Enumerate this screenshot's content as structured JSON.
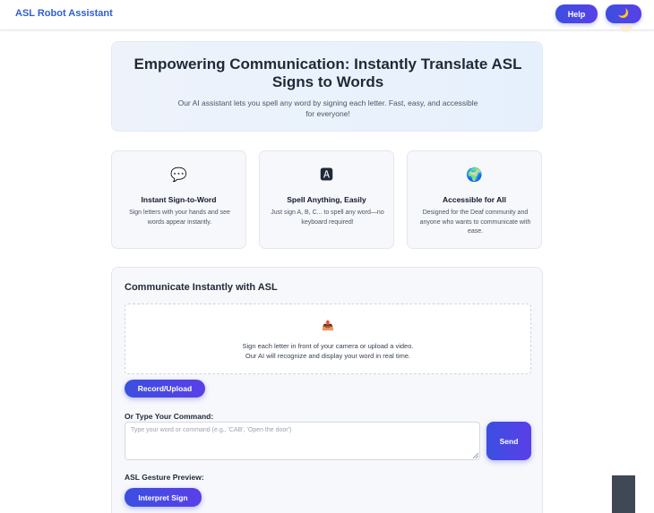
{
  "navbar": {
    "brand": "ASL Robot Assistant",
    "help_label": "Help",
    "theme_toggle_icon": "moon-icon",
    "theme_toggle_glyph": "🌙"
  },
  "hero": {
    "title": "Empowering Communication: Instantly Translate ASL Signs to Words",
    "subtitle": "Our AI assistant lets you spell any word by signing each letter. Fast, easy, and accessible for everyone!"
  },
  "features": [
    {
      "icon": "speech-bubble-icon",
      "glyph": "💬",
      "title": "Instant Sign-to-Word",
      "description": "Sign letters with your hands and see words appear instantly."
    },
    {
      "icon": "letter-a-icon",
      "glyph": "🅰",
      "title": "Spell Anything, Easily",
      "description": "Just sign A, B, C... to spell any word—no keyboard required!"
    },
    {
      "icon": "globe-icon",
      "glyph": "🌍",
      "title": "Accessible for All",
      "description": "Designed for the Deaf community and anyone who wants to communicate with ease."
    }
  ],
  "panel": {
    "title": "Communicate Instantly with ASL",
    "dropzone": {
      "icon": "upload-icon",
      "glyph": "📤",
      "line1": "Sign each letter in front of your camera or upload a video.",
      "line2": "Our AI will recognize and display your word in real time."
    },
    "record_label": "Record/Upload",
    "type_label": "Or Type Your Command:",
    "command_placeholder": "Type your word or command (e.g., 'CAB', 'Open the door')",
    "command_value": "",
    "send_label": "Send",
    "preview_label": "ASL Gesture Preview:",
    "interpret_label": "Interpret Sign"
  },
  "colors": {
    "brand": "#2f5fd0",
    "button_gradient_start": "#3b4fe0",
    "button_gradient_end": "#5a3fe8",
    "hero_bg": "#eef3fb",
    "card_bg": "#f6f8fb"
  }
}
